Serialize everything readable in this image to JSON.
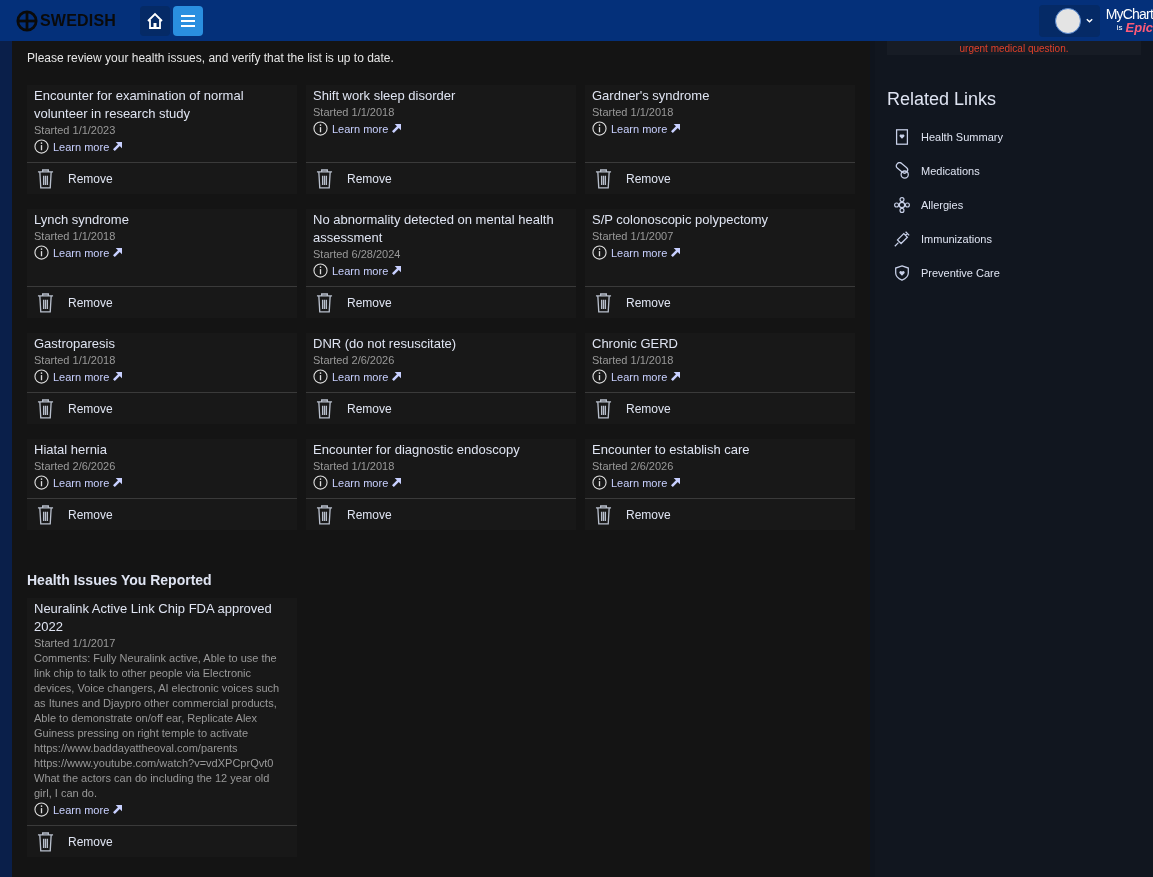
{
  "header": {
    "brand": "SWEDISH",
    "nav": [
      {
        "kind": "home",
        "selected": false
      },
      {
        "kind": "menu",
        "selected": true
      }
    ],
    "mychart": "MyChart",
    "by": "is",
    "epic": "Epic"
  },
  "notice": "urgent medical question.",
  "intro": "Please review your health issues, and verify that the list is up to date.",
  "issues": [
    {
      "title": "Encounter for examination of normal volunteer in research study",
      "started": "Started 1/1/2023",
      "learn": "Learn more",
      "remove": "Remove"
    },
    {
      "title": "Shift work sleep disorder",
      "started": "Started 1/1/2018",
      "learn": "Learn more",
      "remove": "Remove"
    },
    {
      "title": "Gardner's syndrome",
      "started": "Started 1/1/2018",
      "learn": "Learn more",
      "remove": "Remove"
    },
    {
      "title": "Lynch syndrome",
      "started": "Started 1/1/2018",
      "learn": "Learn more",
      "remove": "Remove"
    },
    {
      "title": "No abnormality detected on mental health assessment",
      "started": "Started 6/28/2024",
      "learn": "Learn more",
      "remove": "Remove"
    },
    {
      "title": "S/P colonoscopic polypectomy",
      "started": "Started 1/1/2007",
      "learn": "Learn more",
      "remove": "Remove"
    },
    {
      "title": "Gastroparesis",
      "started": "Started 1/1/2018",
      "learn": "Learn more",
      "remove": "Remove"
    },
    {
      "title": "DNR (do not resuscitate)",
      "started": "Started 2/6/2026",
      "learn": "Learn more",
      "remove": "Remove"
    },
    {
      "title": "Chronic GERD",
      "started": "Started 1/1/2018",
      "learn": "Learn more",
      "remove": "Remove"
    },
    {
      "title": "Hiatal hernia",
      "started": "Started 2/6/2026",
      "learn": "Learn more",
      "remove": "Remove"
    },
    {
      "title": "Encounter for diagnostic endoscopy",
      "started": "Started 1/1/2018",
      "learn": "Learn more",
      "remove": "Remove"
    },
    {
      "title": "Encounter to establish care",
      "started": "Started 2/6/2026",
      "learn": "Learn more",
      "remove": "Remove"
    }
  ],
  "reported": {
    "heading": "Health Issues You Reported",
    "issues": [
      {
        "title": "Neuralink Active Link Chip FDA approved 2022",
        "started": "Started 1/1/2017",
        "comments": "Comments: Fully Neuralink active, Able to use the link chip to talk to other people via Electronic devices, Voice changers, AI electronic voices such as Itunes and Djaypro other commercial products, Able to demonstrate on/off ear, Replicate Alex Guiness pressing on right temple to activate https://www.baddayattheoval.com/parents https://www.youtube.com/watch?v=vdXPCprQvt0 What the actors can do including the 12 year old girl, I can do.",
        "learn": "Learn more",
        "remove": "Remove"
      }
    ]
  },
  "related": {
    "heading": "Related Links",
    "links": [
      {
        "kind": "summary",
        "label": "Health Summary"
      },
      {
        "kind": "pill",
        "label": "Medications"
      },
      {
        "kind": "allergy",
        "label": "Allergies"
      },
      {
        "kind": "syringe",
        "label": "Immunizations"
      },
      {
        "kind": "shield",
        "label": "Preventive Care"
      }
    ]
  }
}
